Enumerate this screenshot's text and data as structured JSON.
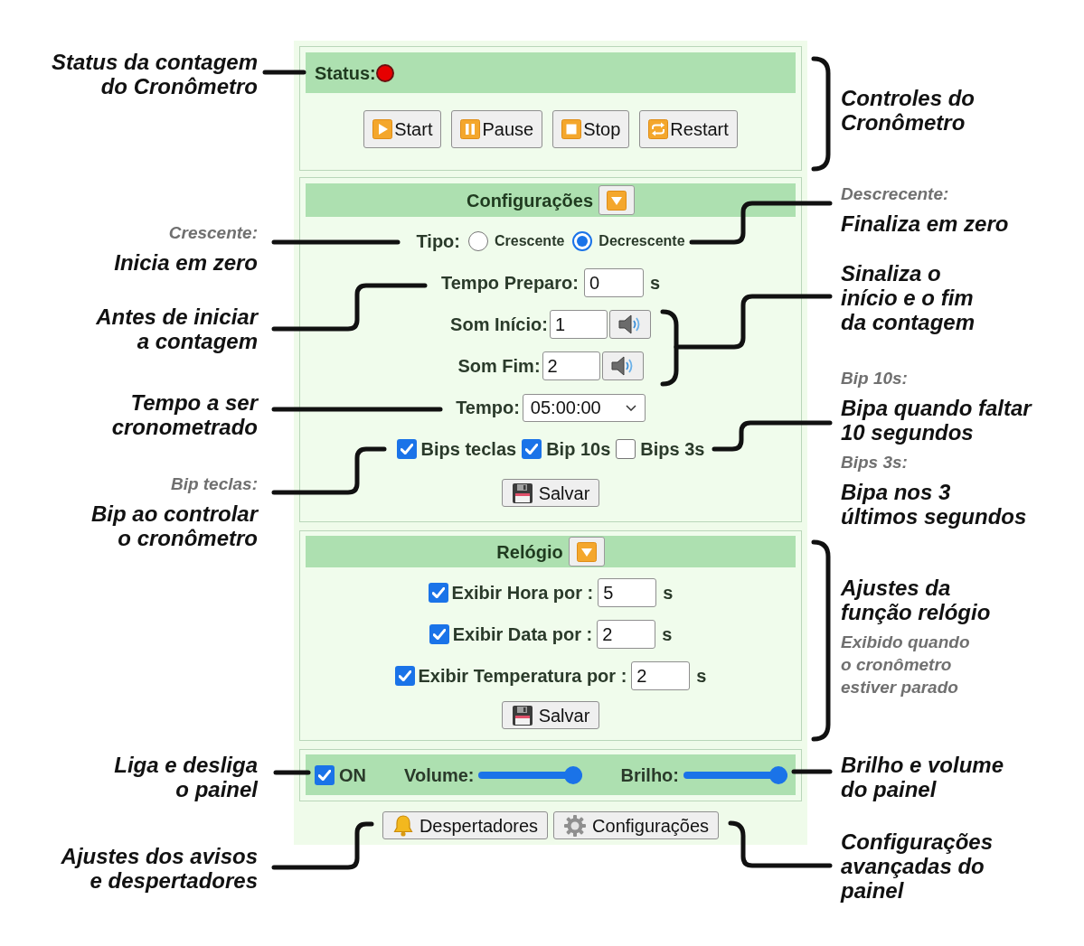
{
  "status": {
    "label": "Status:",
    "running": false
  },
  "controls": [
    {
      "kind": "start",
      "label": "Start"
    },
    {
      "kind": "pause",
      "label": "Pause"
    },
    {
      "kind": "stop",
      "label": "Stop"
    },
    {
      "kind": "restart",
      "label": "Restart"
    }
  ],
  "configuracoes": {
    "title": "Configurações",
    "rows": [
      {
        "kind": "radio",
        "label": "Tipo:",
        "options": [
          {
            "label": "Crescente",
            "selected": false
          },
          {
            "label": "Decrescente",
            "selected": true
          }
        ]
      },
      {
        "kind": "number",
        "label": "Tempo Preparo:",
        "value": "0",
        "unit": "s"
      },
      {
        "kind": "sound",
        "label": "Som Início:",
        "value": "1"
      },
      {
        "kind": "sound",
        "label": "Som Fim:",
        "value": "2"
      },
      {
        "kind": "select",
        "label": "Tempo:",
        "value": "05:00:00"
      },
      {
        "kind": "checks",
        "options": [
          {
            "label": "Bips teclas",
            "checked": true
          },
          {
            "label": "Bip 10s",
            "checked": true
          },
          {
            "label": "Bips 3s",
            "checked": false
          }
        ]
      }
    ],
    "save": "Salvar"
  },
  "relogio": {
    "title": "Relógio",
    "rows": [
      {
        "label": "Exibir Hora por :",
        "checked": true,
        "value": "5",
        "unit": "s"
      },
      {
        "label": "Exibir Data por :",
        "checked": true,
        "value": "2",
        "unit": "s"
      },
      {
        "label": "Exibir Temperatura por :",
        "checked": true,
        "value": "2",
        "unit": "s"
      }
    ],
    "save": "Salvar"
  },
  "display": {
    "power": {
      "label": "ON",
      "checked": true
    },
    "sliders": [
      {
        "label": "Volume:",
        "level": 1
      },
      {
        "label": "Brilho:",
        "level": 1
      }
    ]
  },
  "footer_buttons": [
    {
      "kind": "bell",
      "label": "Despertadores"
    },
    {
      "kind": "gear",
      "label": "Configurações"
    }
  ],
  "annotations": {
    "left": [
      {
        "parts": [
          {
            "kind": "main",
            "text": "Status da contagem\ndo Cronômetro"
          }
        ]
      },
      {
        "parts": [
          {
            "kind": "note",
            "text": "Crescente:"
          },
          {
            "kind": "main",
            "text": "Inicia em zero"
          }
        ]
      },
      {
        "parts": [
          {
            "kind": "main",
            "text": "Antes de iniciar\na contagem"
          }
        ]
      },
      {
        "parts": [
          {
            "kind": "main",
            "text": "Tempo a ser\ncronometrado"
          }
        ]
      },
      {
        "parts": [
          {
            "kind": "note",
            "text": "Bip teclas:"
          },
          {
            "kind": "main",
            "text": "Bip ao controlar\no cronômetro"
          }
        ]
      },
      {
        "parts": [
          {
            "kind": "main",
            "text": "Liga e desliga\no painel"
          }
        ]
      },
      {
        "parts": [
          {
            "kind": "main",
            "text": "Ajustes dos avisos\ne despertadores"
          }
        ]
      }
    ],
    "right": [
      {
        "parts": [
          {
            "kind": "main",
            "text": "Controles do\nCronômetro"
          }
        ]
      },
      {
        "parts": [
          {
            "kind": "note",
            "text": "Descrecente:"
          },
          {
            "kind": "main",
            "text": "Finaliza em zero"
          }
        ]
      },
      {
        "parts": [
          {
            "kind": "main",
            "text": "Sinaliza o\ninício e o fim\nda contagem"
          }
        ]
      },
      {
        "parts": [
          {
            "kind": "note",
            "text": "Bip 10s:"
          },
          {
            "kind": "main",
            "text": "Bipa quando faltar\n10 segundos"
          },
          {
            "kind": "note",
            "text": "Bips 3s:"
          },
          {
            "kind": "main",
            "text": "Bipa nos 3\núltimos segundos"
          }
        ]
      },
      {
        "parts": [
          {
            "kind": "main",
            "text": "Ajustes da\nfunção relógio"
          },
          {
            "kind": "note",
            "text": "Exibido quando\no cronômetro\nestiver parado"
          }
        ]
      },
      {
        "parts": [
          {
            "kind": "main",
            "text": "Brilho e volume\ndo painel"
          }
        ]
      },
      {
        "parts": [
          {
            "kind": "main",
            "text": "Configurações\navançadas do\npainel"
          }
        ]
      }
    ]
  }
}
